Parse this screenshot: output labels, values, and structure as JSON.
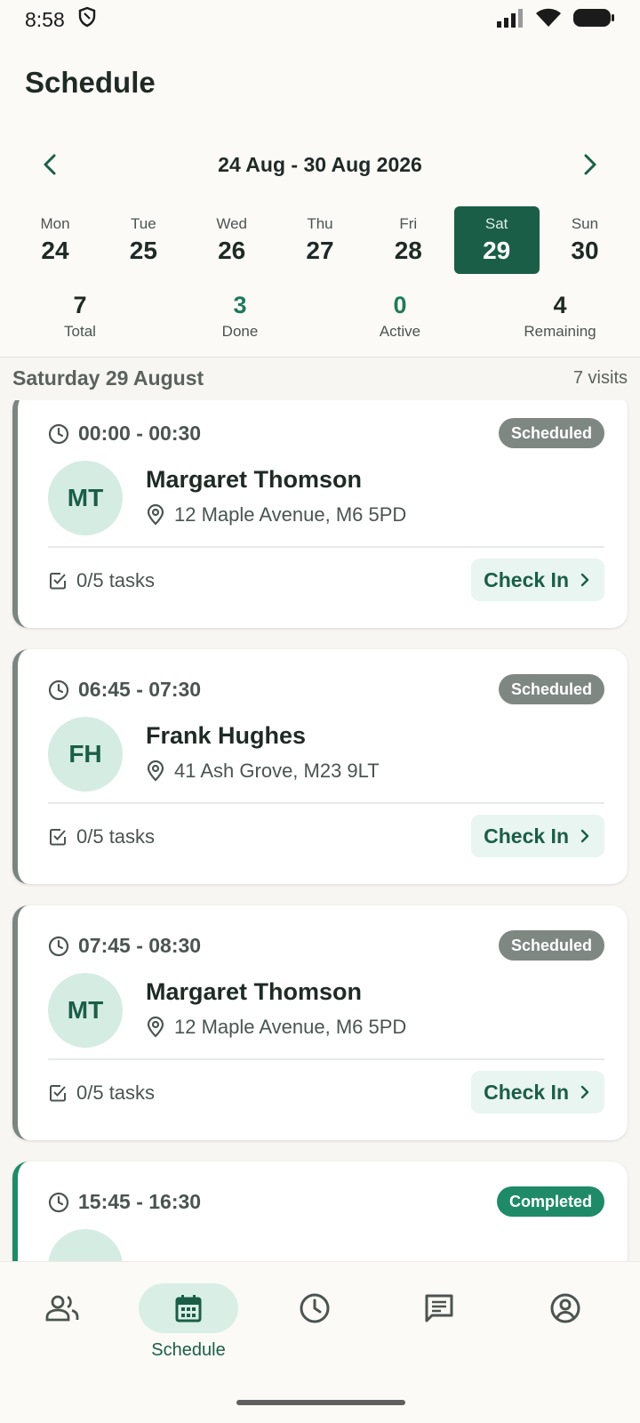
{
  "status_bar": {
    "time": "8:58"
  },
  "header": {
    "title": "Schedule"
  },
  "week": {
    "range": "24 Aug - 30 Aug 2026",
    "days": [
      {
        "name": "Mon",
        "num": "24"
      },
      {
        "name": "Tue",
        "num": "25"
      },
      {
        "name": "Wed",
        "num": "26"
      },
      {
        "name": "Thu",
        "num": "27"
      },
      {
        "name": "Fri",
        "num": "28"
      },
      {
        "name": "Sat",
        "num": "29"
      },
      {
        "name": "Sun",
        "num": "30"
      }
    ],
    "selected_index": 5
  },
  "stats": [
    {
      "value": "7",
      "label": "Total"
    },
    {
      "value": "3",
      "label": "Done"
    },
    {
      "value": "0",
      "label": "Active"
    },
    {
      "value": "4",
      "label": "Remaining"
    }
  ],
  "day_header": {
    "title": "Saturday 29 August",
    "count": "7 visits"
  },
  "visits": [
    {
      "time": "00:00 - 00:30",
      "status": "Scheduled",
      "initials": "MT",
      "name": "Margaret Thomson",
      "address": "12 Maple Avenue, M6 5PD",
      "tasks": "0/5 tasks",
      "action": "Check In"
    },
    {
      "time": "06:45 - 07:30",
      "status": "Scheduled",
      "initials": "FH",
      "name": "Frank Hughes",
      "address": "41 Ash Grove, M23 9LT",
      "tasks": "0/5 tasks",
      "action": "Check In"
    },
    {
      "time": "07:45 - 08:30",
      "status": "Scheduled",
      "initials": "MT",
      "name": "Margaret Thomson",
      "address": "12 Maple Avenue, M6 5PD",
      "tasks": "0/5 tasks",
      "action": "Check In"
    },
    {
      "time": "15:45 - 16:30",
      "status": "Completed",
      "initials": "",
      "name": "",
      "address": "",
      "tasks": "",
      "action": ""
    }
  ],
  "bottom_nav": {
    "items": [
      {
        "icon": "people-icon",
        "label": ""
      },
      {
        "icon": "calendar-icon",
        "label": "Schedule"
      },
      {
        "icon": "clock-icon",
        "label": ""
      },
      {
        "icon": "message-icon",
        "label": ""
      },
      {
        "icon": "profile-icon",
        "label": ""
      }
    ],
    "active_index": 1
  },
  "colors": {
    "primary": "#1b5e47",
    "accent": "#1f8a67",
    "scheduled_badge": "#7f8783",
    "background": "#f7f6f2"
  }
}
